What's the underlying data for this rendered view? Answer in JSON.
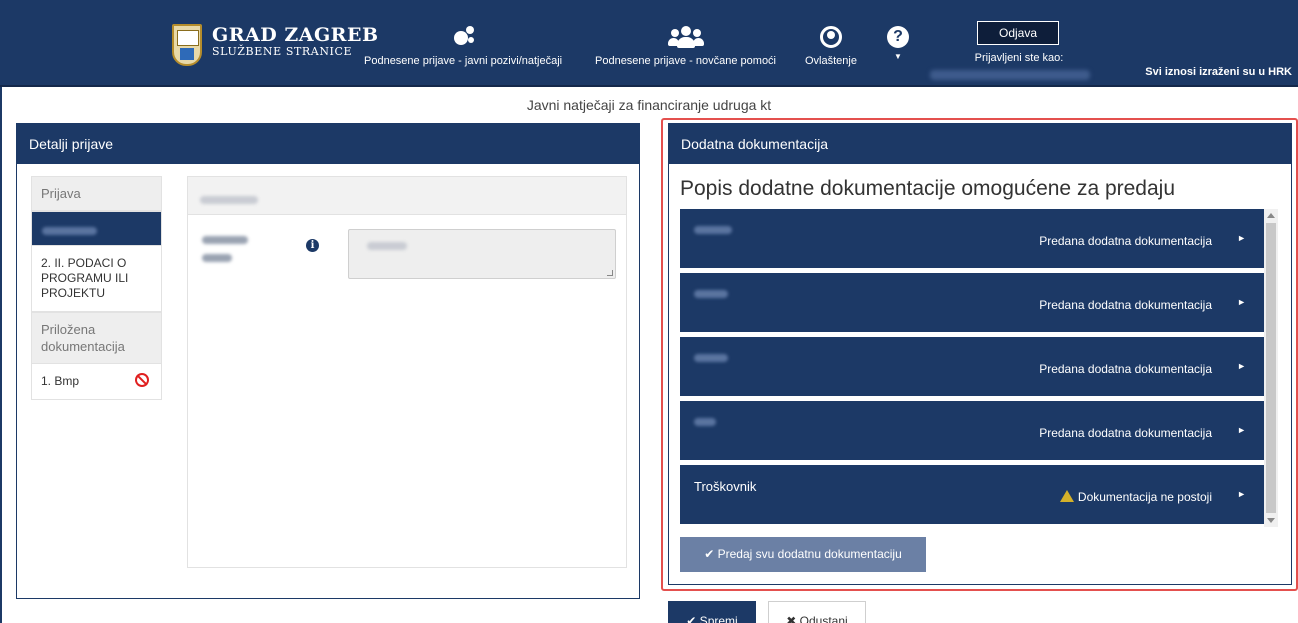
{
  "header": {
    "logo_title": "GRAD ZAGREB",
    "logo_subtitle": "SLUŽBENE STRANICE",
    "nav": [
      {
        "label": "Podnesene prijave - javni pozivi/natječaji",
        "icon": "gears-icon"
      },
      {
        "label": "Podnesene prijave - novčane pomoći",
        "icon": "users-icon"
      },
      {
        "label": "Ovlaštenje",
        "icon": "user-circle-icon"
      },
      {
        "label": "",
        "icon": "help-icon"
      }
    ],
    "logout_label": "Odjava",
    "logged_in_label": "Prijavljeni ste kao:",
    "currency_note": "Svi iznosi izraženi su u HRK"
  },
  "page_title": "Javni natječaji za financiranje udruga kt",
  "left_panel": {
    "title": "Detalji prijave",
    "nav": {
      "section_application": "Prijava",
      "item_2": "2. II. PODACI O PROGRAMU ILI PROJEKTU",
      "section_attached": "Priložena dokumentacija",
      "item_bmp": "1. Bmp"
    }
  },
  "right_panel": {
    "header": "Dodatna dokumentacija",
    "title": "Popis dodatne dokumentacije omogućene za predaju",
    "documents": [
      {
        "status": "Predana dodatna dokumentacija"
      },
      {
        "status": "Predana dodatna dokumentacija"
      },
      {
        "status": "Predana dodatna dokumentacija"
      },
      {
        "status": "Predana dodatna dokumentacija"
      },
      {
        "name": "Troškovnik",
        "status": "Dokumentacija ne postoji"
      }
    ],
    "submit_all_label": "✔ Predaj svu dodatnu dokumentaciju"
  },
  "actions": {
    "save_label": "✔ Spremi",
    "cancel_label": "✖ Odustani"
  },
  "colors": {
    "primary": "#1c3966",
    "highlight": "#e4504e",
    "warning": "#d4b12a",
    "danger": "#e02020"
  }
}
